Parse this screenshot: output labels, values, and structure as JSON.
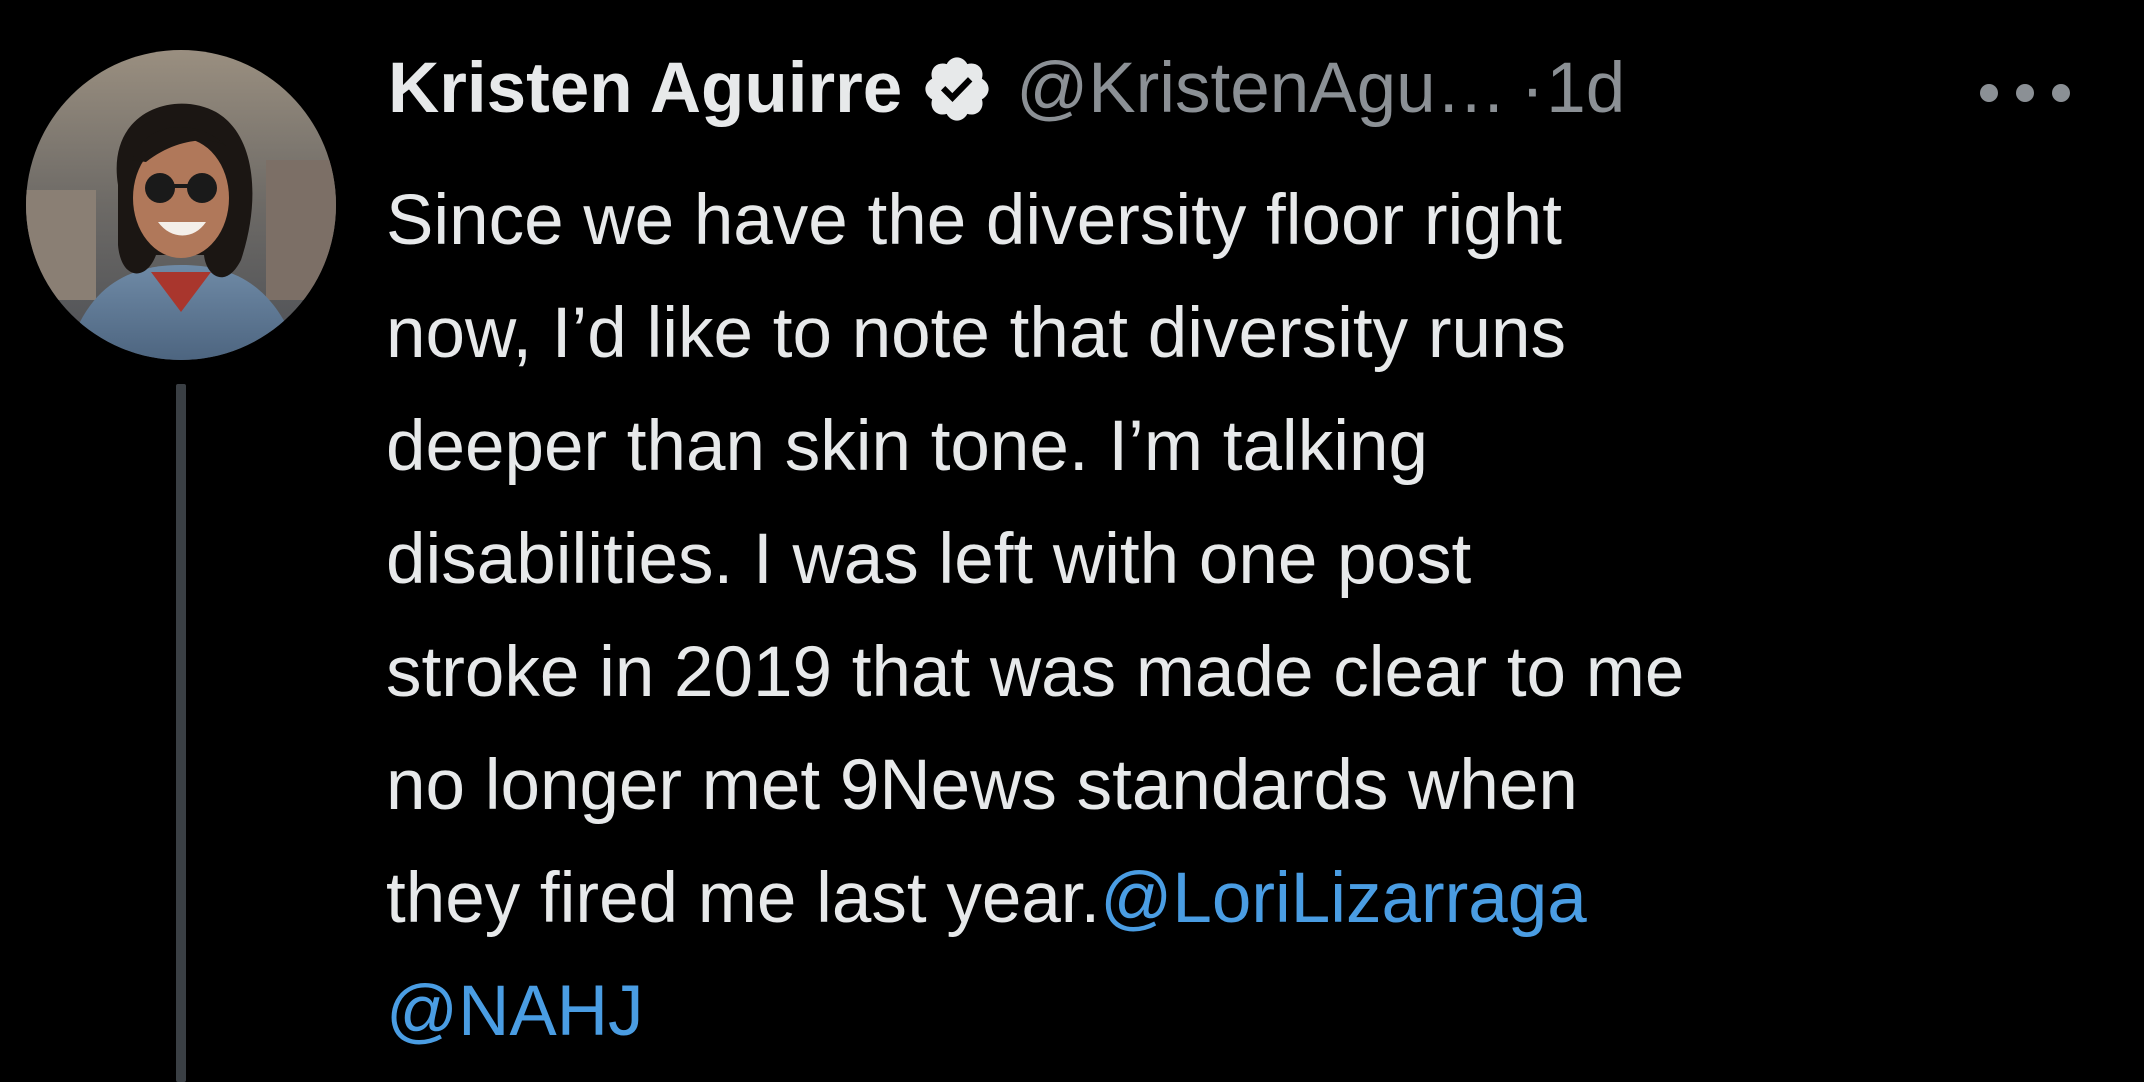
{
  "tweet": {
    "author": {
      "display_name": "Kristen Aguirre",
      "handle": "@KristenAgu…",
      "verified_icon": "verified-badge-icon"
    },
    "separator": "·",
    "timestamp": "1d",
    "more_icon": "more-options-icon",
    "text_lines": [
      "Since we have the diversity floor right",
      "now, I’d like to note that diversity runs",
      "deeper than skin tone. I’m talking",
      "disabilities. I was left with one post",
      "stroke in 2019 that was made clear to me",
      "no longer met 9News standards when",
      "they fired me last year."
    ],
    "mentions": [
      "@LoriLizarraga",
      "@NAHJ"
    ]
  },
  "colors": {
    "background": "#000000",
    "primary_text": "#e7e9ea",
    "secondary_text": "#8b9095",
    "link": "#4a9de3",
    "thread_line": "#3a3f44"
  }
}
